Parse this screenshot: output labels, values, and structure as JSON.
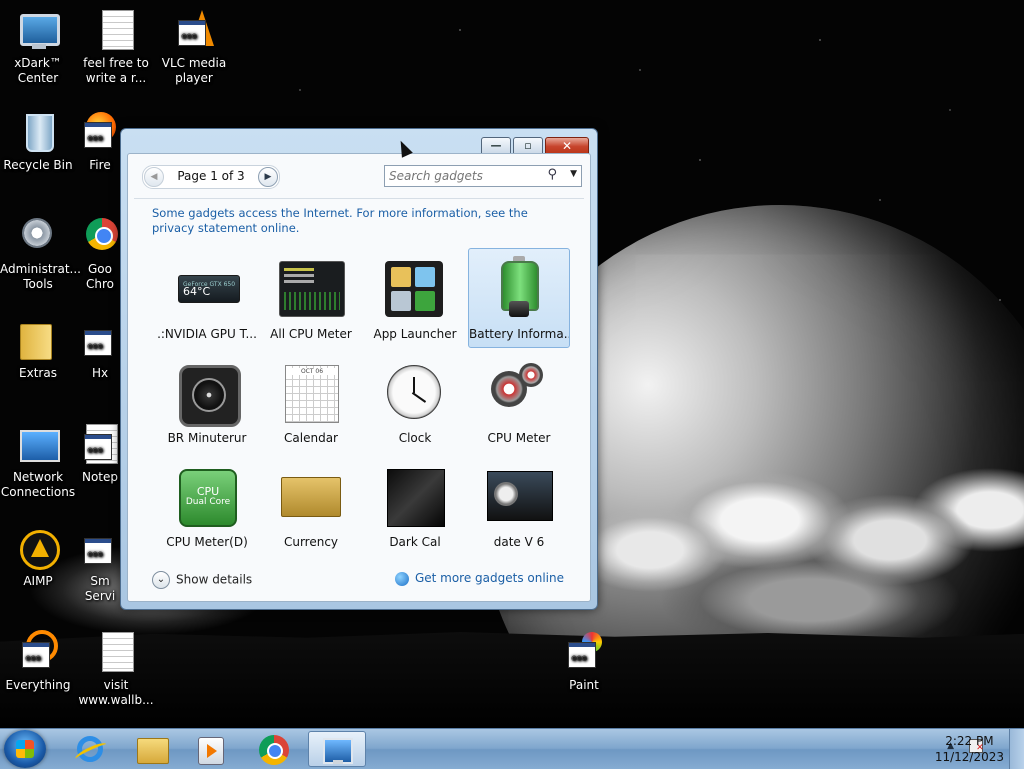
{
  "desktop": {
    "icons": [
      {
        "label": "xDark™ Center"
      },
      {
        "label": "feel free to write a r..."
      },
      {
        "label": "VLC media player"
      },
      {
        "label": "Recycle Bin"
      },
      {
        "label": "Fire"
      },
      {
        "label": "Administrat... Tools"
      },
      {
        "label": "Goo Chro"
      },
      {
        "label": "Extras"
      },
      {
        "label": "Hx"
      },
      {
        "label": "Network Connections"
      },
      {
        "label": "Notep"
      },
      {
        "label": "AIMP"
      },
      {
        "label": "Sm Servi"
      },
      {
        "label": "Everything"
      },
      {
        "label": "visit www.wallb..."
      },
      {
        "label": "Paint"
      }
    ]
  },
  "gadget_window": {
    "pager": {
      "text": "Page 1 of 3"
    },
    "search": {
      "placeholder": "Search gadgets"
    },
    "notice": "Some gadgets access the Internet.  For more information, see the privacy statement online.",
    "gadgets": [
      {
        "name": ".:NVIDIA GPU T...",
        "thumb_text": "64°C",
        "thumb_sub": "GeForce GTX 650"
      },
      {
        "name": "All CPU Meter"
      },
      {
        "name": "App Launcher"
      },
      {
        "name": "Battery Informa...",
        "selected": true
      },
      {
        "name": "BR Minuterur"
      },
      {
        "name": "Calendar",
        "thumb_text": "OCT 06"
      },
      {
        "name": "Clock"
      },
      {
        "name": "CPU Meter"
      },
      {
        "name": "CPU Meter(D)",
        "thumb_text": "CPU",
        "thumb_sub": "Dual Core"
      },
      {
        "name": "Currency"
      },
      {
        "name": "Dark Cal"
      },
      {
        "name": "date V 6"
      }
    ],
    "footer": {
      "show_details": "Show details",
      "get_more": "Get more gadgets online"
    }
  },
  "taskbar": {
    "clock_time": "2:22 PM",
    "clock_date": "11/12/2023",
    "tray_arrow": "▲"
  }
}
